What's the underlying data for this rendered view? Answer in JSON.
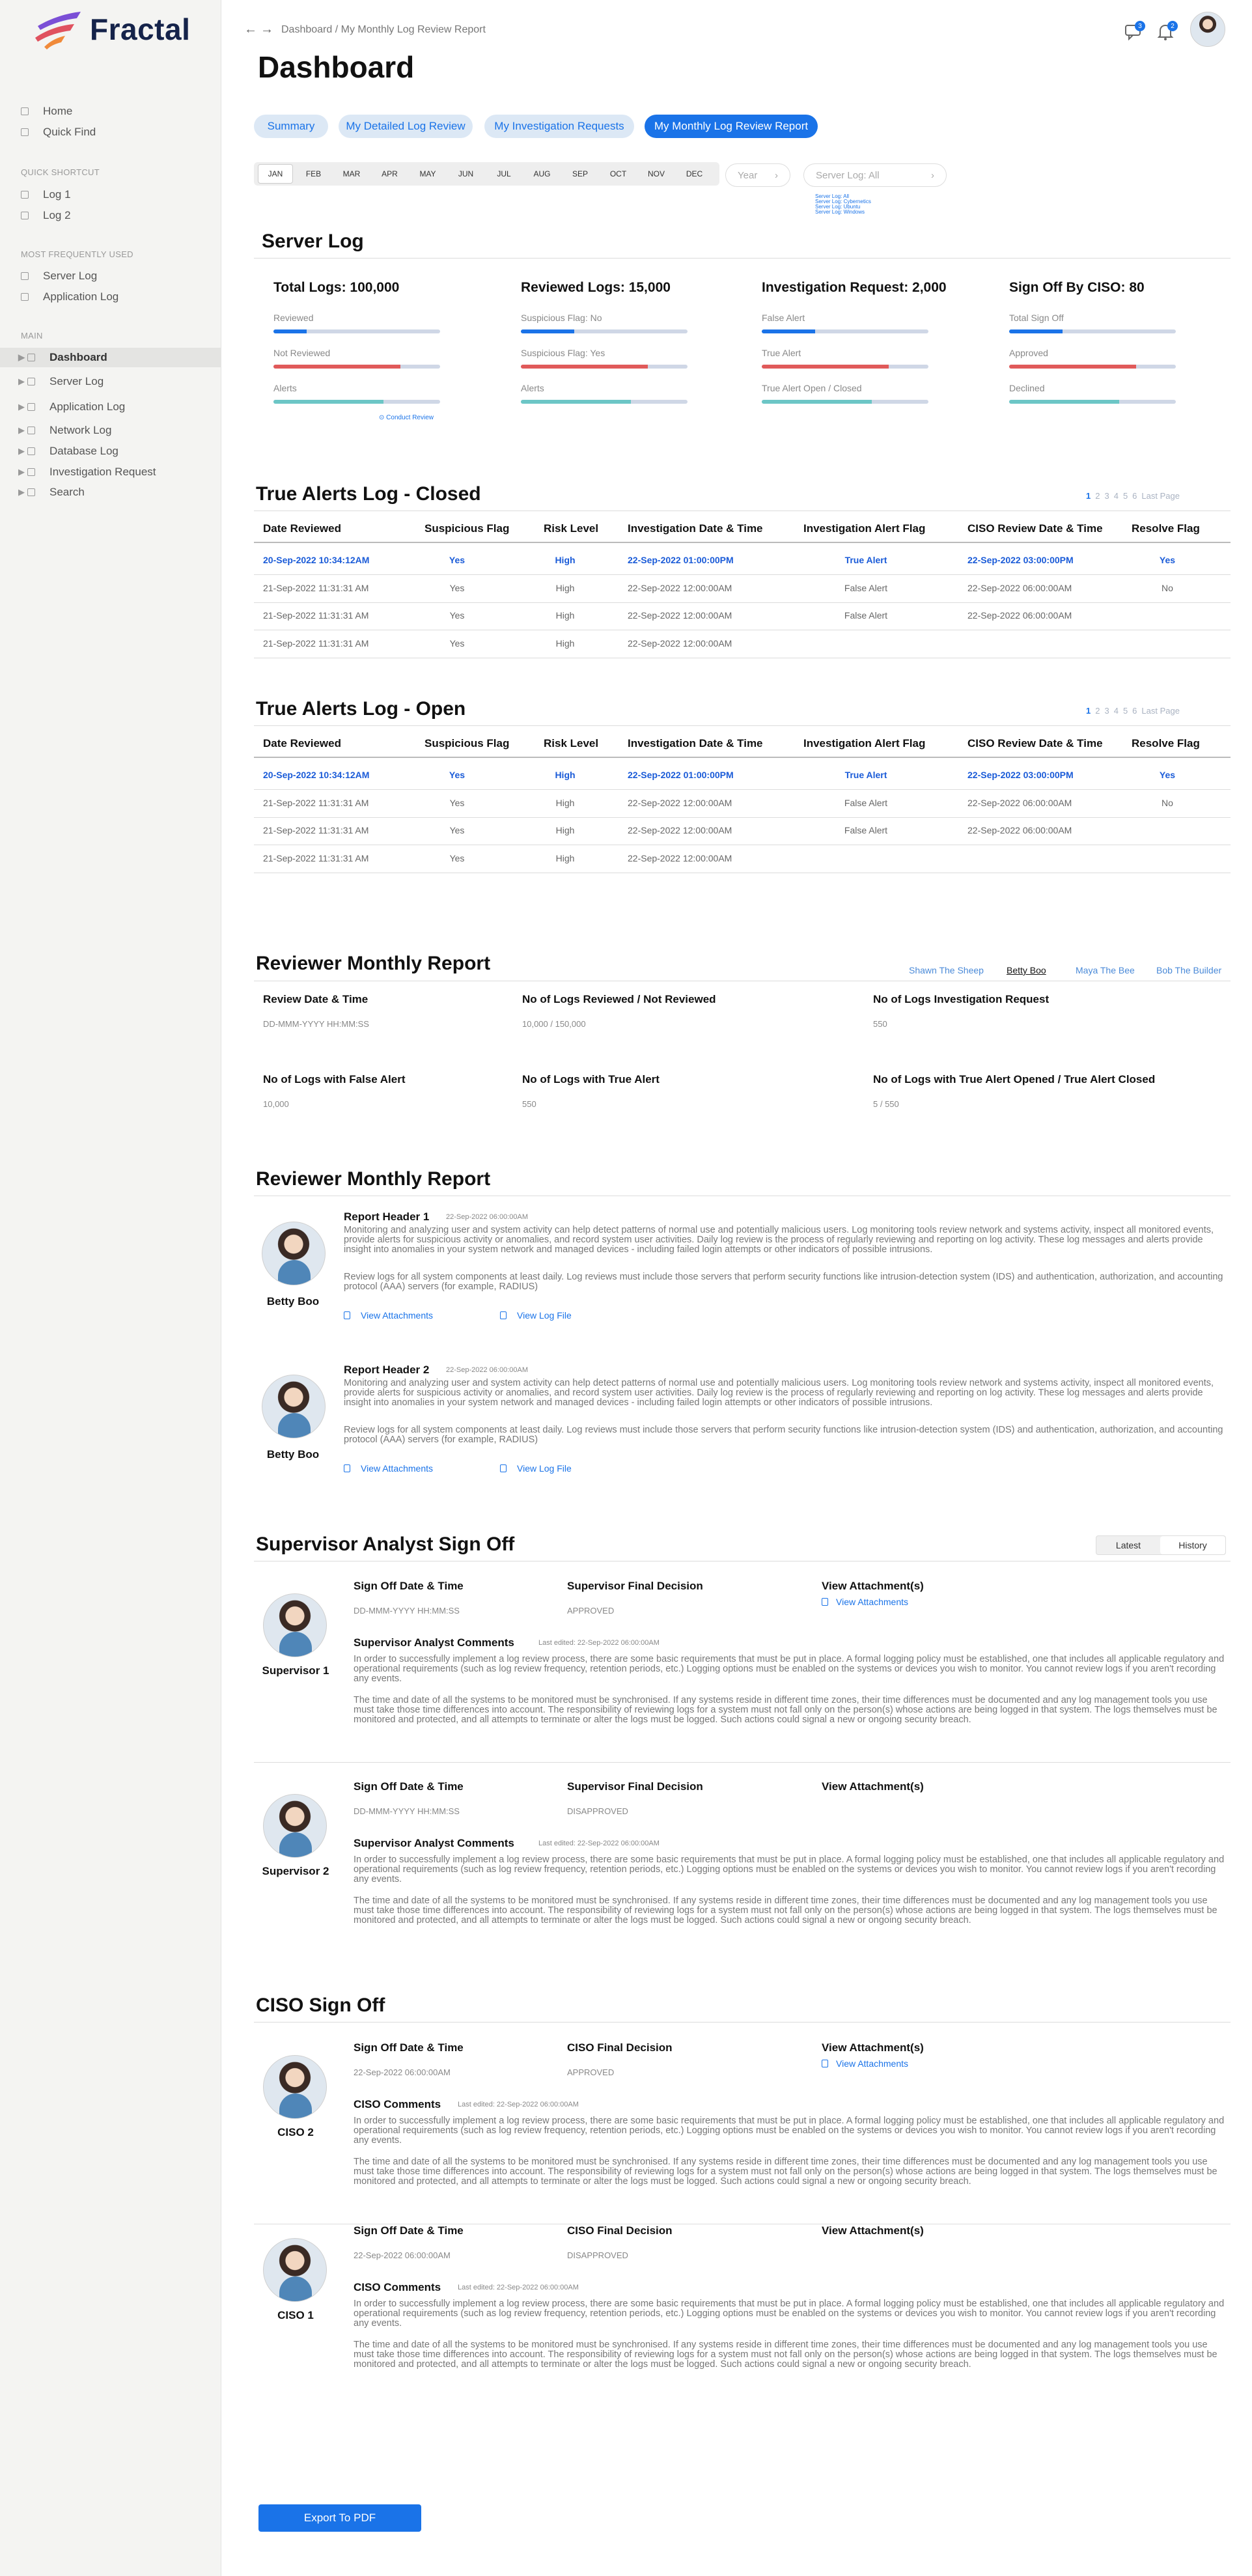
{
  "app": {
    "logo_text": "Fractal"
  },
  "sidebar": {
    "top_items": [
      {
        "label": "Home"
      },
      {
        "label": "Quick Find"
      }
    ],
    "quick_shortcut_title": "QUICK SHORTCUT",
    "shortcuts": [
      {
        "label": "Log 1"
      },
      {
        "label": "Log 2"
      }
    ],
    "frequent_title": "MOST FREQUENTLY USED",
    "frequent": [
      {
        "label": "Server Log"
      },
      {
        "label": "Application Log"
      }
    ],
    "main_title": "MAIN",
    "main_items": [
      {
        "label": "Dashboard"
      },
      {
        "label": "Server Log"
      },
      {
        "label": "Application Log"
      },
      {
        "label": "Network Log"
      },
      {
        "label": "Database Log"
      },
      {
        "label": "Investigation Request"
      },
      {
        "label": "Search"
      }
    ]
  },
  "header": {
    "breadcrumb": "Dashboard / My Monthly Log Review Report",
    "page_title": "Dashboard",
    "chat_badge": "3",
    "bell_badge": "2"
  },
  "tabs": [
    "Summary",
    "My Detailed Log Review",
    "My Investigation Requests",
    "My Monthly Log Review Report"
  ],
  "months": [
    "JAN",
    "FEB",
    "MAR",
    "APR",
    "MAY",
    "JUN",
    "JUL",
    "AUG",
    "SEP",
    "OCT",
    "NOV",
    "DEC"
  ],
  "filters": {
    "year_placeholder": "Year",
    "server_log_select": "Server Log: All",
    "server_log_options": [
      "Server Log: All",
      "Server Log: Cybernetics",
      "Server Log: Ubuntu",
      "Server Log: Windows"
    ]
  },
  "server_log": {
    "title": "Server Log",
    "stats": [
      {
        "title": "Total Logs: 100,000",
        "rows": [
          {
            "label": "Reviewed",
            "value": 0.2,
            "color": "#1a73e8"
          },
          {
            "label": "Not Reviewed",
            "value": 0.76,
            "color": "#e05a5a"
          },
          {
            "label": "Alerts",
            "value": 0.66,
            "color": "#6cc6c6"
          }
        ]
      },
      {
        "title": "Reviewed Logs: 15,000",
        "rows": [
          {
            "label": "Suspicious Flag: No",
            "value": 0.32,
            "color": "#1a73e8"
          },
          {
            "label": "Suspicious Flag: Yes",
            "value": 0.76,
            "color": "#e05a5a"
          },
          {
            "label": "Alerts",
            "value": 0.66,
            "color": "#6cc6c6"
          }
        ]
      },
      {
        "title": "Investigation Request: 2,000",
        "rows": [
          {
            "label": "False Alert",
            "value": 0.32,
            "color": "#1a73e8"
          },
          {
            "label": "True Alert",
            "value": 0.76,
            "color": "#e05a5a"
          },
          {
            "label": "True Alert Open / Closed",
            "value": 0.66,
            "color": "#6cc6c6"
          }
        ]
      },
      {
        "title": "Sign Off By CISO: 80",
        "rows": [
          {
            "label": "Total Sign Off",
            "value": 0.32,
            "color": "#1a73e8"
          },
          {
            "label": "Approved",
            "value": 0.76,
            "color": "#e05a5a"
          },
          {
            "label": "Declined",
            "value": 0.66,
            "color": "#6cc6c6"
          }
        ]
      }
    ],
    "conduct_review": "Conduct Review"
  },
  "table_headers": [
    "Date Reviewed",
    "Suspicious Flag",
    "Risk Level",
    "Investigation Date & Time",
    "Investigation Alert Flag",
    "CISO Review Date & Time",
    "Resolve Flag"
  ],
  "pagination": {
    "items": [
      "1",
      "2",
      "3",
      "4",
      "5",
      "6"
    ],
    "last": "Last Page"
  },
  "closed_log": {
    "title": "True Alerts Log - Closed",
    "rows": [
      [
        "20-Sep-2022 10:34:12AM",
        "Yes",
        "High",
        "22-Sep-2022 01:00:00PM",
        "True Alert",
        "22-Sep-2022 03:00:00PM",
        "Yes"
      ],
      [
        "21-Sep-2022 11:31:31 AM",
        "Yes",
        "High",
        "22-Sep-2022 12:00:00AM",
        "False Alert",
        "22-Sep-2022 06:00:00AM",
        "No"
      ],
      [
        "21-Sep-2022 11:31:31 AM",
        "Yes",
        "High",
        "22-Sep-2022 12:00:00AM",
        "False Alert",
        "22-Sep-2022 06:00:00AM",
        ""
      ],
      [
        "21-Sep-2022 11:31:31 AM",
        "Yes",
        "High",
        "22-Sep-2022 12:00:00AM",
        "",
        "",
        ""
      ]
    ]
  },
  "open_log": {
    "title": "True Alerts Log - Open",
    "rows": [
      [
        "20-Sep-2022 10:34:12AM",
        "Yes",
        "High",
        "22-Sep-2022 01:00:00PM",
        "True Alert",
        "22-Sep-2022 03:00:00PM",
        "Yes"
      ],
      [
        "21-Sep-2022 11:31:31 AM",
        "Yes",
        "High",
        "22-Sep-2022 12:00:00AM",
        "False Alert",
        "22-Sep-2022 06:00:00AM",
        "No"
      ],
      [
        "21-Sep-2022 11:31:31 AM",
        "Yes",
        "High",
        "22-Sep-2022 12:00:00AM",
        "False Alert",
        "22-Sep-2022 06:00:00AM",
        ""
      ],
      [
        "21-Sep-2022 11:31:31 AM",
        "Yes",
        "High",
        "22-Sep-2022 12:00:00AM",
        "",
        "",
        ""
      ]
    ]
  },
  "reviewer_report": {
    "title": "Reviewer Monthly Report",
    "reviewers": [
      "Shawn The Sheep",
      "Betty Boo",
      "Maya The Bee",
      "Bob The Builder"
    ],
    "fields": [
      {
        "label": "Review Date & Time",
        "value": "DD-MMM-YYYY HH:MM:SS"
      },
      {
        "label": "No of Logs Reviewed / Not Reviewed",
        "value": "10,000 / 150,000"
      },
      {
        "label": "No of Logs Investigation Request",
        "value": "550"
      },
      {
        "label": "No of Logs with False Alert",
        "value": "10,000"
      },
      {
        "label": "No of Logs with True Alert",
        "value": "550"
      },
      {
        "label": "No of Logs with True Alert Opened / True Alert Closed",
        "value": "5 / 550"
      }
    ]
  },
  "reviewer_report2": {
    "title": "Reviewer Monthly Report",
    "entries": [
      {
        "name": "Betty Boo",
        "header": "Report Header 1",
        "date": "22-Sep-2022 06:00:00AM",
        "p1": "Monitoring and analyzing user and system activity can help detect patterns of normal use and potentially malicious users. Log monitoring tools review network and systems activity, inspect all monitored events, provide alerts for suspicious activity or anomalies, and record system user activities. Daily log review is the process of regularly reviewing and reporting on log activity. These log messages and alerts provide insight into anomalies in your system network and managed devices - including failed login attempts or other indicators of possible intrusions.",
        "p2": "Review logs for all system components at least daily. Log reviews must include those servers that perform security functions like intrusion-detection system (IDS) and authentication, authorization, and accounting protocol (AAA) servers (for example, RADIUS)",
        "attach": "View Attachments",
        "logfile": "View Log File"
      },
      {
        "name": "Betty Boo",
        "header": "Report Header 2",
        "date": "22-Sep-2022 06:00:00AM",
        "p1": "Monitoring and analyzing user and system activity can help detect patterns of normal use and potentially malicious users. Log monitoring tools review network and systems activity, inspect all monitored events, provide alerts for suspicious activity or anomalies, and record system user activities. Daily log review is the process of regularly reviewing and reporting on log activity. These log messages and alerts provide insight into anomalies in your system network and managed devices - including failed login attempts or other indicators of possible intrusions.",
        "p2": "Review logs for all system components at least daily. Log reviews must include those servers that perform security functions like intrusion-detection system (IDS) and authentication, authorization, and accounting protocol (AAA) servers (for example, RADIUS)",
        "attach": "View Attachments",
        "logfile": "View Log File"
      }
    ]
  },
  "supervisor": {
    "title": "Supervisor Analyst Sign Off",
    "toggle": [
      "Latest",
      "History"
    ],
    "entries": [
      {
        "name": "Supervisor 1",
        "date_label": "Sign Off Date & Time",
        "date": "DD-MMM-YYYY HH:MM:SS",
        "decision_label": "Supervisor Final Decision",
        "decision": "APPROVED",
        "attach_label": "View Attachment(s)",
        "attach": "View Attachments",
        "comments_label": "Supervisor Analyst Comments",
        "edited": "Last edited: 22-Sep-2022 06:00:00AM",
        "p1": "In order to successfully implement a log review process, there are some basic requirements that must be put in place. A formal logging policy must be established, one that includes all applicable regulatory and operational requirements (such as log review frequency, retention periods, etc.) Logging options must be enabled on the systems or devices you wish to monitor. You cannot review logs if you aren't recording any events.",
        "p2": "The time and date of all the systems to be monitored must be synchronised. If any systems reside in different time zones, their time differences must be documented and any log management tools you use must take those time differences into account. The responsibility of reviewing logs for a system must not fall only on the person(s) whose actions are being logged in that system. The logs themselves must be monitored and protected, and all attempts to terminate or alter the logs must be logged. Such actions could signal a new or ongoing security breach."
      },
      {
        "name": "Supervisor 2",
        "date_label": "Sign Off Date & Time",
        "date": "DD-MMM-YYYY HH:MM:SS",
        "decision_label": "Supervisor Final Decision",
        "decision": "DISAPPROVED",
        "attach_label": "View Attachment(s)",
        "attach": "",
        "comments_label": "Supervisor Analyst Comments",
        "edited": "Last edited: 22-Sep-2022 06:00:00AM",
        "p1": "In order to successfully implement a log review process, there are some basic requirements that must be put in place. A formal logging policy must be established, one that includes all applicable regulatory and operational requirements (such as log review frequency, retention periods, etc.) Logging options must be enabled on the systems or devices you wish to monitor. You cannot review logs if you aren't recording any events.",
        "p2": "The time and date of all the systems to be monitored must be synchronised. If any systems reside in different time zones, their time differences must be documented and any log management tools you use must take those time differences into account. The responsibility of reviewing logs for a system must not fall only on the person(s) whose actions are being logged in that system. The logs themselves must be monitored and protected, and all attempts to terminate or alter the logs must be logged. Such actions could signal a new or ongoing security breach."
      }
    ]
  },
  "ciso": {
    "title": "CISO Sign Off",
    "entries": [
      {
        "name": "CISO 2",
        "date_label": "Sign Off Date & Time",
        "date": "22-Sep-2022 06:00:00AM",
        "decision_label": "CISO Final Decision",
        "decision": "APPROVED",
        "attach_label": "View Attachment(s)",
        "attach": "View Attachments",
        "comments_label": "CISO Comments",
        "edited": "Last edited: 22-Sep-2022 06:00:00AM",
        "p1": "In order to successfully implement a log review process, there are some basic requirements that must be put in place. A formal logging policy must be established, one that includes all applicable regulatory and operational requirements (such as log review frequency, retention periods, etc.) Logging options must be enabled on the systems or devices you wish to monitor. You cannot review logs if you aren't recording any events.",
        "p2": "The time and date of all the systems to be monitored must be synchronised. If any systems reside in different time zones, their time differences must be documented and any log management tools you use must take those time differences into account. The responsibility of reviewing logs for a system must not fall only on the person(s) whose actions are being logged in that system. The logs themselves must be monitored and protected, and all attempts to terminate or alter the logs must be logged. Such actions could signal a new or ongoing security breach."
      },
      {
        "name": "CISO 1",
        "date_label": "Sign Off Date & Time",
        "date": "22-Sep-2022 06:00:00AM",
        "decision_label": "CISO Final Decision",
        "decision": "DISAPPROVED",
        "attach_label": "View Attachment(s)",
        "attach": "",
        "comments_label": "CISO Comments",
        "edited": "Last edited: 22-Sep-2022 06:00:00AM",
        "p1": "In order to successfully implement a log review process, there are some basic requirements that must be put in place. A formal logging policy must be established, one that includes all applicable regulatory and operational requirements (such as log review frequency, retention periods, etc.) Logging options must be enabled on the systems or devices you wish to monitor. You cannot review logs if you aren't recording any events.",
        "p2": "The time and date of all the systems to be monitored must be synchronised. If any systems reside in different time zones, their time differences must be documented and any log management tools you use must take those time differences into account. The responsibility of reviewing logs for a system must not fall only on the person(s) whose actions are being logged in that system. The logs themselves must be monitored and protected, and all attempts to terminate or alter the logs must be logged. Such actions could signal a new or ongoing security breach."
      }
    ]
  },
  "export_label": "Export To PDF"
}
